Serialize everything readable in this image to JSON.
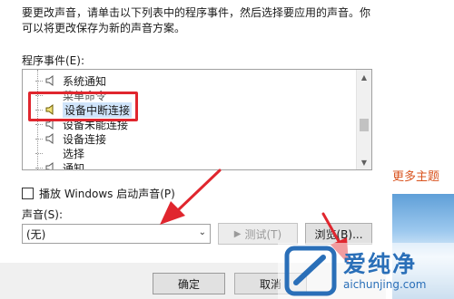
{
  "description": "要更改声音，请单击以下列表中的程序事件，然后选择要应用的声音。你可以将更改保存为新的声音方案。",
  "program_events_label": "程序事件(E):",
  "events": [
    {
      "label": "系统通知",
      "icon": "speaker-icon",
      "selected": false
    },
    {
      "label": "菜单命令",
      "icon": "none",
      "selected": false
    },
    {
      "label": "设备中断连接",
      "icon": "speaker-icon",
      "selected": true
    },
    {
      "label": "设备未能连接",
      "icon": "speaker-icon",
      "selected": false
    },
    {
      "label": "设备连接",
      "icon": "speaker-icon",
      "selected": false
    },
    {
      "label": "选择",
      "icon": "none",
      "selected": false
    },
    {
      "label": "通知",
      "icon": "speaker-icon",
      "selected": false
    }
  ],
  "checkbox": {
    "label": "播放 Windows 启动声音(P)",
    "checked": false
  },
  "sound_label": "声音(S):",
  "sound_select": {
    "value": "(无)"
  },
  "buttons": {
    "test": "测试(T)",
    "browse": "浏览(B)...",
    "ok": "确定",
    "cancel": "取消"
  },
  "background": {
    "link_text": "更多主题"
  },
  "watermark": {
    "cn": "爱纯净",
    "en": "aichunjing.com"
  },
  "colors": {
    "highlight_box": "#e0262e",
    "selection": "#cfe4fa",
    "link": "#d9531e",
    "watermark": "#2a6fb8"
  }
}
